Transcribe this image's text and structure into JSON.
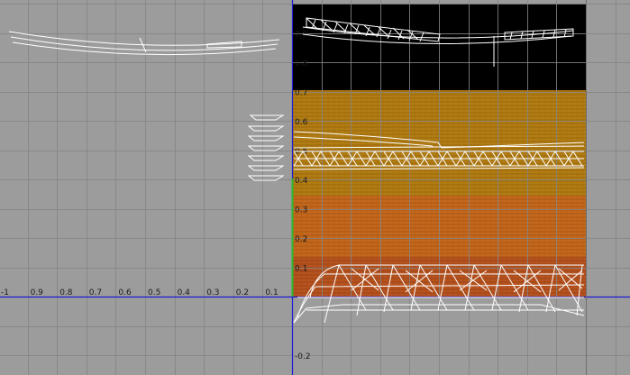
{
  "colors": {
    "background": "#9c9c9c",
    "grid": "#858585",
    "axis": "#1b1bd6",
    "v_axis_green": "#2db82d",
    "texture_black": "#000000",
    "texture_ochre": "#b07a10",
    "texture_orange": "#c2651a",
    "texture_rust": "#b4501c",
    "wire": "#ffffff",
    "label": "#1a1a1a"
  },
  "axes": {
    "u_labels": [
      "-1",
      "0.9",
      "0.8",
      "0.7",
      "0.6",
      "0.5",
      "0.4",
      "0.3",
      "0.2",
      "0.1"
    ],
    "v_labels": [
      "0.9",
      "0.8",
      "0.7",
      "0.6",
      "0.5",
      "0.4",
      "0.3",
      "0.2",
      "0.1",
      "-0.2"
    ]
  },
  "icons": {
    "texture_tile": "uv-texture-tile-icon"
  }
}
